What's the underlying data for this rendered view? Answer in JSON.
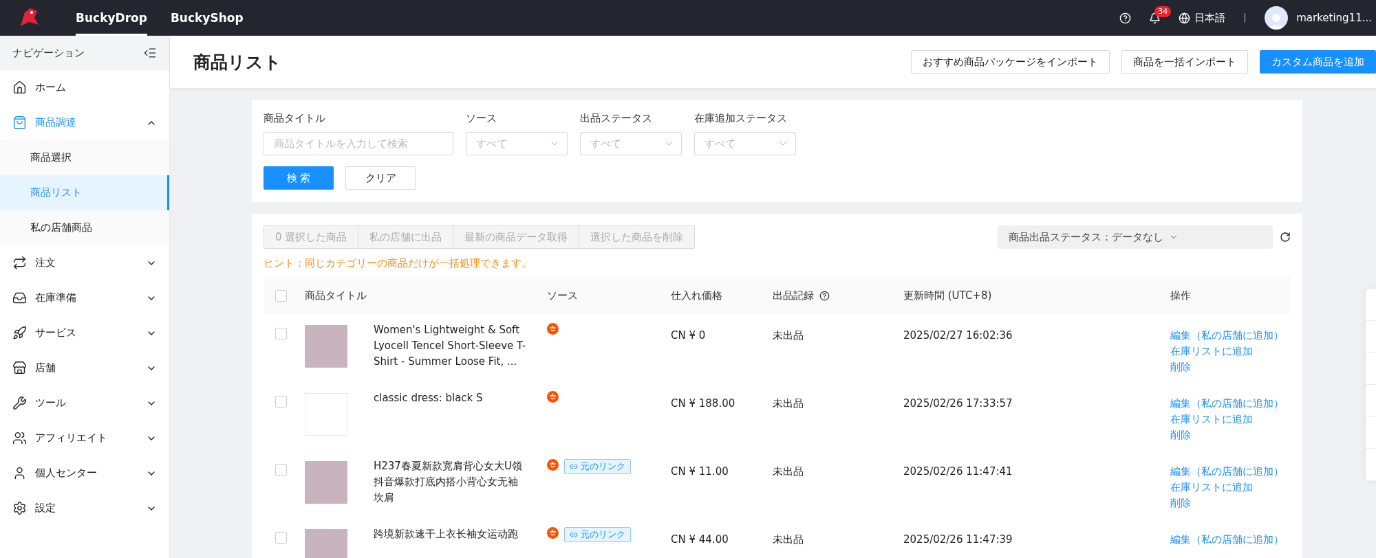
{
  "topbar": {
    "tabs": [
      {
        "label": "BuckyDrop",
        "selected": true
      },
      {
        "label": "BuckyShop",
        "selected": false
      }
    ],
    "notification_count": "34",
    "language": "日本語",
    "user": "marketing11..."
  },
  "sidebar": {
    "title": "ナビゲーション",
    "items": [
      {
        "label": "ホーム",
        "selected": false
      },
      {
        "label": "商品調達",
        "selected": true,
        "expanded": true,
        "children": [
          {
            "label": "商品選択",
            "selected": false
          },
          {
            "label": "商品リスト",
            "selected": true
          },
          {
            "label": "私の店舗商品",
            "selected": false
          }
        ]
      },
      {
        "label": "注文",
        "selected": false,
        "expanded": false
      },
      {
        "label": "在庫準備",
        "selected": false,
        "expanded": false
      },
      {
        "label": "サービス",
        "selected": false,
        "expanded": false
      },
      {
        "label": "店舗",
        "selected": false,
        "expanded": false
      },
      {
        "label": "ツール",
        "selected": false,
        "expanded": false
      },
      {
        "label": "アフィリエイト",
        "selected": false,
        "expanded": false
      },
      {
        "label": "個人センター",
        "selected": false,
        "expanded": false
      },
      {
        "label": "設定",
        "selected": false,
        "expanded": false
      }
    ]
  },
  "page": {
    "title": "商品リスト",
    "actions": [
      {
        "label": "おすすめ商品パッケージをインポート",
        "kind": "default"
      },
      {
        "label": "商品を一括インポート",
        "kind": "default"
      },
      {
        "label": "カスタム商品を追加",
        "kind": "primary"
      }
    ]
  },
  "filters": {
    "fields": [
      {
        "label": "商品タイトル",
        "kind": "input",
        "placeholder": "商品タイトルを入力して検索"
      },
      {
        "label": "ソース",
        "kind": "select",
        "placeholder": "すべて"
      },
      {
        "label": "出品ステータス",
        "kind": "select",
        "placeholder": "すべて"
      },
      {
        "label": "在庫追加ステータス",
        "kind": "select",
        "placeholder": "すべて"
      }
    ],
    "buttons": [
      {
        "label": "検 索",
        "kind": "primary"
      },
      {
        "label": "クリア",
        "kind": "default"
      }
    ]
  },
  "bulk_actions": [
    {
      "label": "0 選択した商品",
      "disabled": true
    },
    {
      "label": "私の店舗に出品",
      "disabled": true
    },
    {
      "label": "最新の商品データ取得",
      "disabled": true
    },
    {
      "label": "選択した商品を削除",
      "disabled": true
    }
  ],
  "status_filter": "商品出品ステータス：データなし",
  "hint": "ヒント：同じカテゴリーの商品だけが一括処理できます。",
  "table": {
    "all_checked": false,
    "columns": [
      {
        "label": "商品タイトル",
        "help": false
      },
      {
        "label": "ソース",
        "help": false
      },
      {
        "label": "仕入れ価格",
        "help": false
      },
      {
        "label": "出品記録",
        "help": true
      },
      {
        "label": "更新時間 (UTC+8)",
        "help": false
      },
      {
        "label": "操作",
        "help": false
      }
    ],
    "rows": [
      {
        "checked": false,
        "kind": "photo",
        "title": "Women's Lightweight & Soft Lyocell Tencel Short-Sleeve T-Shirt - Summer Loose Fit, ...",
        "link": null,
        "price": "CN ¥ 0",
        "record": "未出品",
        "updated": "2025/02/27 16:02:36",
        "actions": [
          "編集（私の店舗に追加）",
          "在庫リストに追加",
          "削除"
        ]
      },
      {
        "checked": false,
        "kind": "blank",
        "title": "classic dress: black S",
        "link": null,
        "price": "CN ¥ 188.00",
        "record": "未出品",
        "updated": "2025/02/26 17:33:57",
        "actions": [
          "編集（私の店舗に追加）",
          "在庫リストに追加",
          "削除"
        ]
      },
      {
        "checked": false,
        "kind": "photo",
        "title": "H237春夏新款宽肩背心女大U领抖音爆款打底内搭小背心女无袖坎肩",
        "link": "元のリンク",
        "price": "CN ¥ 11.00",
        "record": "未出品",
        "updated": "2025/02/26 11:47:41",
        "actions": [
          "編集（私の店舗に追加）",
          "在庫リストに追加",
          "削除"
        ]
      },
      {
        "checked": false,
        "kind": "photo",
        "title": "跨境新款速干上衣长袖女运动跑",
        "link": "元のリンク",
        "price": "CN ¥ 44.00",
        "record": "未出品",
        "updated": "2025/02/26 11:47:39",
        "actions": [
          "編集（私の店舗に追加）"
        ]
      }
    ]
  }
}
